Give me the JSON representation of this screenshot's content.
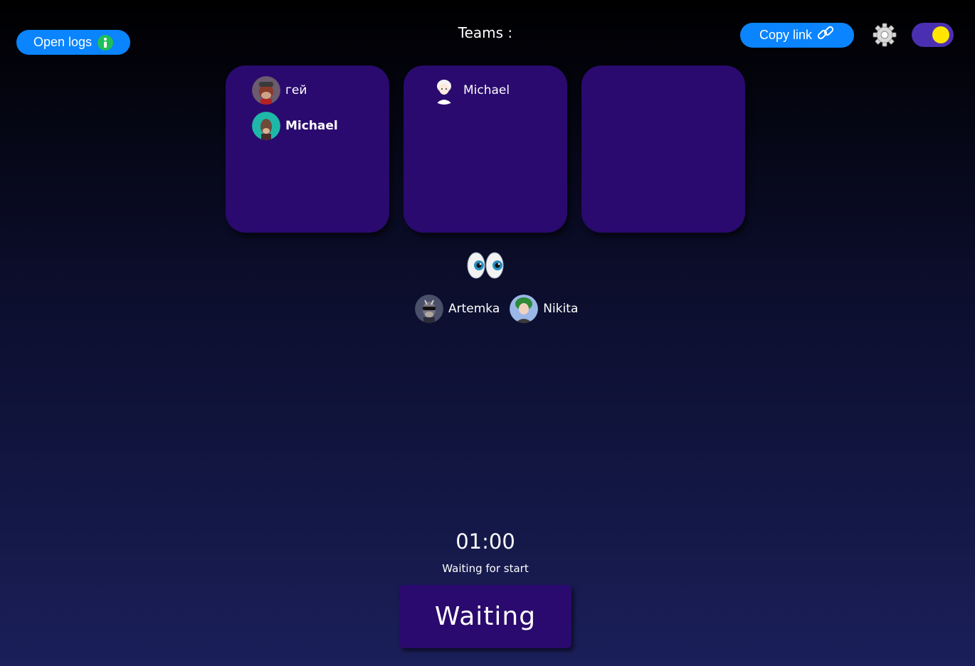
{
  "header": {
    "open_logs_label": "Open logs",
    "teams_title": "Teams :",
    "copy_link_label": "Copy link"
  },
  "teams": [
    {
      "members": [
        {
          "name": "гей",
          "bold": false,
          "avatar": "ape-avatar-red"
        },
        {
          "name": "Michael",
          "bold": true,
          "avatar": "ape-avatar-teal"
        }
      ]
    },
    {
      "members": [
        {
          "name": "Michael",
          "bold": false,
          "avatar": "anime-avatar-white"
        }
      ]
    },
    {
      "members": []
    }
  ],
  "spectators_icon": "eyes-icon",
  "spectators": [
    {
      "name": "Artemka",
      "avatar": "ape-avatar-grey"
    },
    {
      "name": "Nikita",
      "avatar": "anime-avatar-green"
    }
  ],
  "timer": "01:00",
  "status": "Waiting for start",
  "action_button": "Waiting",
  "colors": {
    "accent_blue": "#0a84ff",
    "card_purple": "#2a0a6e",
    "toggle_bg": "#4b2fb2",
    "toggle_knob": "#ffe600",
    "info_green": "#1fbf5a"
  }
}
